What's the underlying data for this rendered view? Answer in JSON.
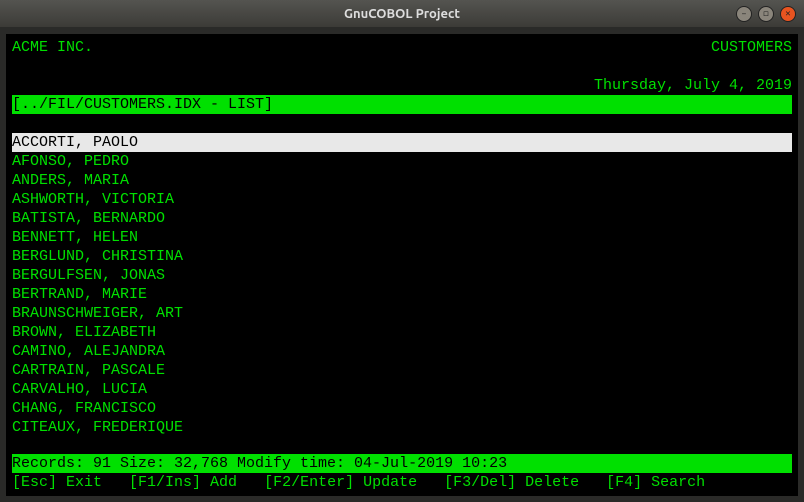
{
  "window": {
    "title": "GnuCOBOL Project"
  },
  "header": {
    "company": "ACME INC.",
    "module": "CUSTOMERS",
    "date": "Thursday, July 4, 2019"
  },
  "subheader": {
    "path": "[../FIL/CUSTOMERS.IDX - LIST]"
  },
  "list": {
    "selected_index": 0,
    "items": [
      "ACCORTI, PAOLO",
      "AFONSO, PEDRO",
      "ANDERS, MARIA",
      "ASHWORTH, VICTORIA",
      "BATISTA, BERNARDO",
      "BENNETT, HELEN",
      "BERGLUND, CHRISTINA",
      "BERGULFSEN, JONAS",
      "BERTRAND, MARIE",
      "BRAUNSCHWEIGER, ART",
      "BROWN, ELIZABETH",
      "CAMINO, ALEJANDRA",
      "CARTRAIN, PASCALE",
      "CARVALHO, LUCIA",
      "CHANG, FRANCISCO",
      "CITEAUX, FREDERIQUE"
    ]
  },
  "status": {
    "text": "Records: 91 Size: 32,768 Modify time: 04-Jul-2019 10:23"
  },
  "footer_keys": [
    {
      "key": "[Esc]",
      "label": "Exit"
    },
    {
      "key": "[F1/Ins]",
      "label": "Add"
    },
    {
      "key": "[F2/Enter]",
      "label": "Update"
    },
    {
      "key": "[F3/Del]",
      "label": "Delete"
    },
    {
      "key": "[F4]",
      "label": "Search"
    }
  ]
}
